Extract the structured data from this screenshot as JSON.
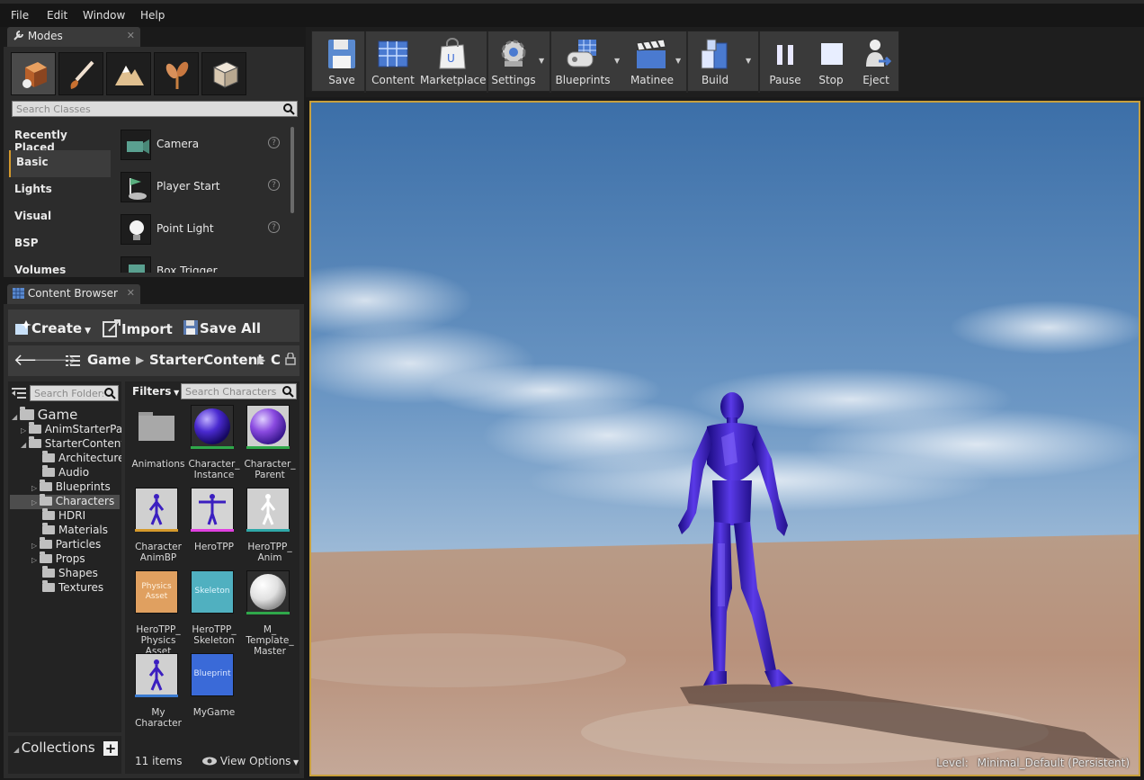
{
  "menu": [
    "File",
    "Edit",
    "Window",
    "Help"
  ],
  "modes": {
    "tab_title": "Modes",
    "search_placeholder": "Search Classes",
    "categories": [
      "Recently Placed",
      "Basic",
      "Lights",
      "Visual",
      "BSP",
      "Volumes"
    ],
    "active_category": "Basic",
    "items": [
      "Camera",
      "Player Start",
      "Point Light",
      "Box Trigger"
    ]
  },
  "content_browser": {
    "tab_title": "Content Browser",
    "create_label": "Create",
    "import_label": "Import",
    "save_all_label": "Save All",
    "breadcrumb": [
      "Game",
      "StarterContent",
      "C"
    ],
    "folder_search_placeholder": "Search Folders",
    "filters_label": "Filters",
    "asset_search_placeholder": "Search Characters",
    "tree": {
      "root": "Game",
      "items": [
        "AnimStarterPack",
        "StarterContent",
        "Architecture",
        "Audio",
        "Blueprints",
        "Characters",
        "HDRI",
        "Materials",
        "Particles",
        "Props",
        "Shapes",
        "Textures"
      ],
      "selected": "Characters"
    },
    "assets": [
      {
        "label": "Animations"
      },
      {
        "label": "Character_\nInstance"
      },
      {
        "label": "Character_\nParent"
      },
      {
        "label": "Character\nAnimBP"
      },
      {
        "label": "HeroTPP"
      },
      {
        "label": "HeroTPP_\nAnim"
      },
      {
        "label": "HeroTPP_\nPhysics\nAsset",
        "thumb_text": "Physics\nAsset"
      },
      {
        "label": "HeroTPP_\nSkeleton",
        "thumb_text": "Skeleton"
      },
      {
        "label": "M_\nTemplate_\nMaster"
      },
      {
        "label": "My\nCharacter"
      },
      {
        "label": "MyGame",
        "thumb_text": "Blueprint"
      }
    ],
    "collections_label": "Collections",
    "item_count": "11 items",
    "view_options_label": "View Options"
  },
  "toolbar": {
    "save": "Save",
    "content": "Content",
    "marketplace": "Marketplace",
    "settings": "Settings",
    "blueprints": "Blueprints",
    "matinee": "Matinee",
    "build": "Build",
    "pause": "Pause",
    "stop": "Stop",
    "eject": "Eject"
  },
  "viewport": {
    "level_label": "Level:",
    "level_name": "Minimal_Default (Persistent)"
  },
  "colors": {
    "accent": "#d59a2b",
    "character": "#3b1fc0",
    "sky_top": "#3c6fa8",
    "ground": "#b8917b"
  }
}
